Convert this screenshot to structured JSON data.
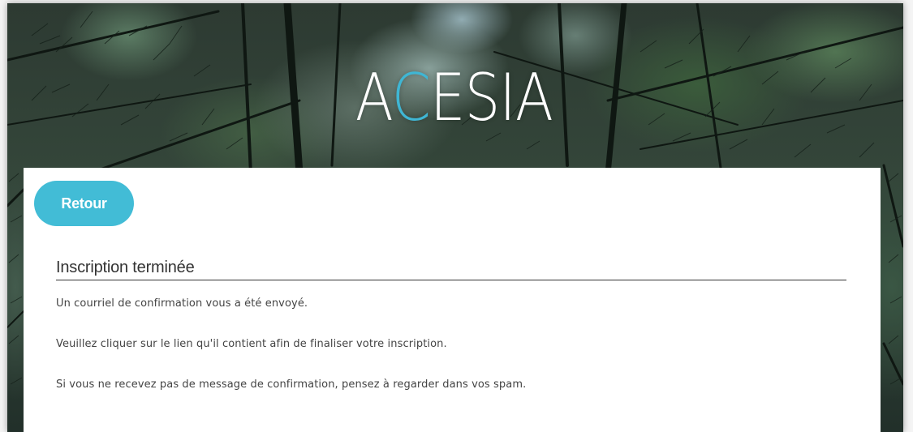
{
  "header": {
    "logo": {
      "text_before": "A",
      "text_accent": "C",
      "text_after": "ESIA",
      "accent_color": "#3fb6d4"
    }
  },
  "actions": {
    "back_label": "Retour"
  },
  "content": {
    "title": "Inscription terminée",
    "messages": [
      "Un courriel de confirmation vous a été envoyé.",
      "Veuillez cliquer sur le lien qu'il contient afin de finaliser votre inscription.",
      "Si vous ne recevez pas de message de confirmation, pensez à regarder dans vos spam."
    ]
  },
  "colors": {
    "button": "#42bcd6",
    "card": "#ffffff",
    "text": "#444444"
  },
  "icons": {
    "background": "pine-forest-image"
  }
}
